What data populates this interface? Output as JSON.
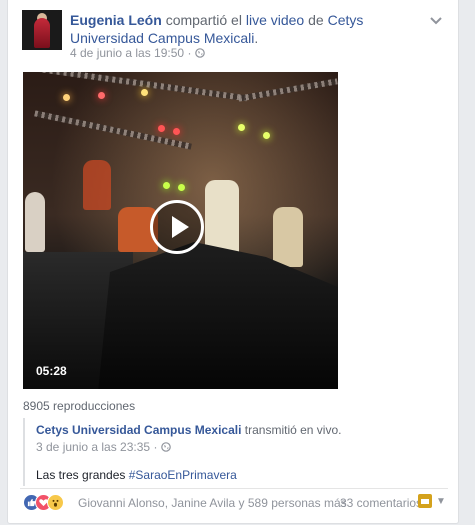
{
  "post": {
    "author": "Eugenia León",
    "action": "compartió el",
    "link_text": "live video",
    "connector": "de",
    "page_name": "Cetys Universidad Campus Mexicali",
    "period": ".",
    "timestamp": "4 de junio a las 19:50",
    "separator": "·",
    "privacy_icon": "globe-icon",
    "options_icon": "chevron-down-icon"
  },
  "video": {
    "duration": "05:28",
    "views": "8905 reproducciones"
  },
  "shared": {
    "page_name": "Cetys Universidad Campus Mexicali",
    "action": "transmitió en vivo.",
    "timestamp": "3 de junio a las 23:35",
    "separator": "·",
    "caption_text": "Las tres grandes",
    "hashtag": "#SaraoEnPrimavera"
  },
  "footer": {
    "reaction_names": "Giovanni Alonso, Janine Avila y 589 personas más",
    "comments": "33 comentarios",
    "reactions": [
      "like",
      "love",
      "wow"
    ]
  },
  "colors": {
    "link": "#365899",
    "meta": "#90949c",
    "like": "#4267b2",
    "love": "#f25268",
    "wow": "#f7c84a"
  }
}
